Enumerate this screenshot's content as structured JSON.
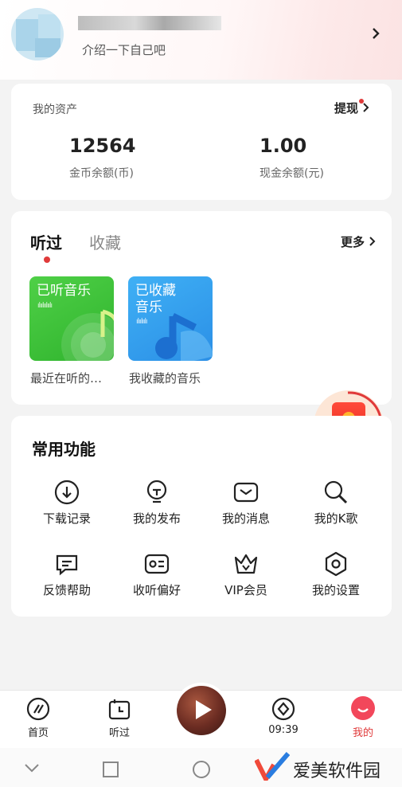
{
  "profile": {
    "intro": "介绍一下自己吧"
  },
  "assets": {
    "title": "我的资产",
    "withdraw": "提现",
    "coins": {
      "value": "12564",
      "label": "金币余额(币)"
    },
    "cash": {
      "value": "1.00",
      "label": "现金余额(元)"
    }
  },
  "listen": {
    "tabs": [
      "听过",
      "收藏"
    ],
    "more": "更多",
    "items": [
      {
        "thumb_title": "已听音乐",
        "caption": "最近在听的…"
      },
      {
        "thumb_title": "已收藏音乐",
        "thumb_line1": "已收藏",
        "thumb_line2": "音乐",
        "caption": "我收藏的音乐"
      }
    ]
  },
  "features": {
    "title": "常用功能",
    "items": [
      {
        "label": "下载记录",
        "icon": "download-icon"
      },
      {
        "label": "我的发布",
        "icon": "publish-icon"
      },
      {
        "label": "我的消息",
        "icon": "message-icon"
      },
      {
        "label": "我的K歌",
        "icon": "karaoke-icon"
      },
      {
        "label": "反馈帮助",
        "icon": "feedback-icon"
      },
      {
        "label": "收听偏好",
        "icon": "preference-icon"
      },
      {
        "label": "VIP会员",
        "icon": "crown-icon"
      },
      {
        "label": "我的设置",
        "icon": "settings-icon"
      }
    ]
  },
  "nav": {
    "items": [
      {
        "label": "首页",
        "icon": "home-icon"
      },
      {
        "label": "听过",
        "icon": "history-icon"
      },
      {
        "label": "09:39",
        "icon": "timer-icon"
      },
      {
        "label": "我的",
        "icon": "mine-icon"
      }
    ],
    "active_color": "#e03a3a"
  },
  "watermark": {
    "text": "爱美软件园"
  }
}
